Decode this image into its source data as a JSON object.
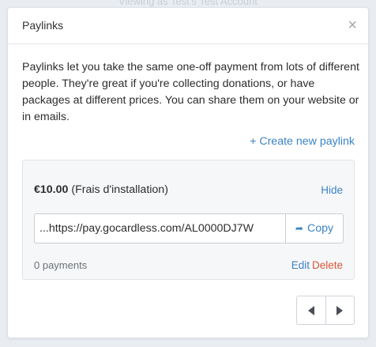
{
  "background": {
    "text": "Viewing as Test's Test Account"
  },
  "modal": {
    "title": "Paylinks",
    "close_glyph": "×",
    "intro": "Paylinks let you take the same one-off payment from lots of different people. They're great if you're collecting donations, or have packages at different prices. You can share them on your website or in emails.",
    "create_link": "+ Create new paylink"
  },
  "paylink": {
    "amount": "€10.00",
    "name": "(Frais d'installation)",
    "hide_label": "Hide",
    "url": "https://pay.gocardless.com/AL0000DJ7W...",
    "copy_label": "Copy",
    "payments": "0 payments",
    "edit_label": "Edit",
    "delete_label": "Delete"
  },
  "colors": {
    "link": "#3b83c4",
    "danger": "#d9583b"
  },
  "icons": {
    "close": "close-icon",
    "copy": "share-arrow-icon",
    "prev": "chevron-left-icon",
    "next": "chevron-right-icon"
  }
}
